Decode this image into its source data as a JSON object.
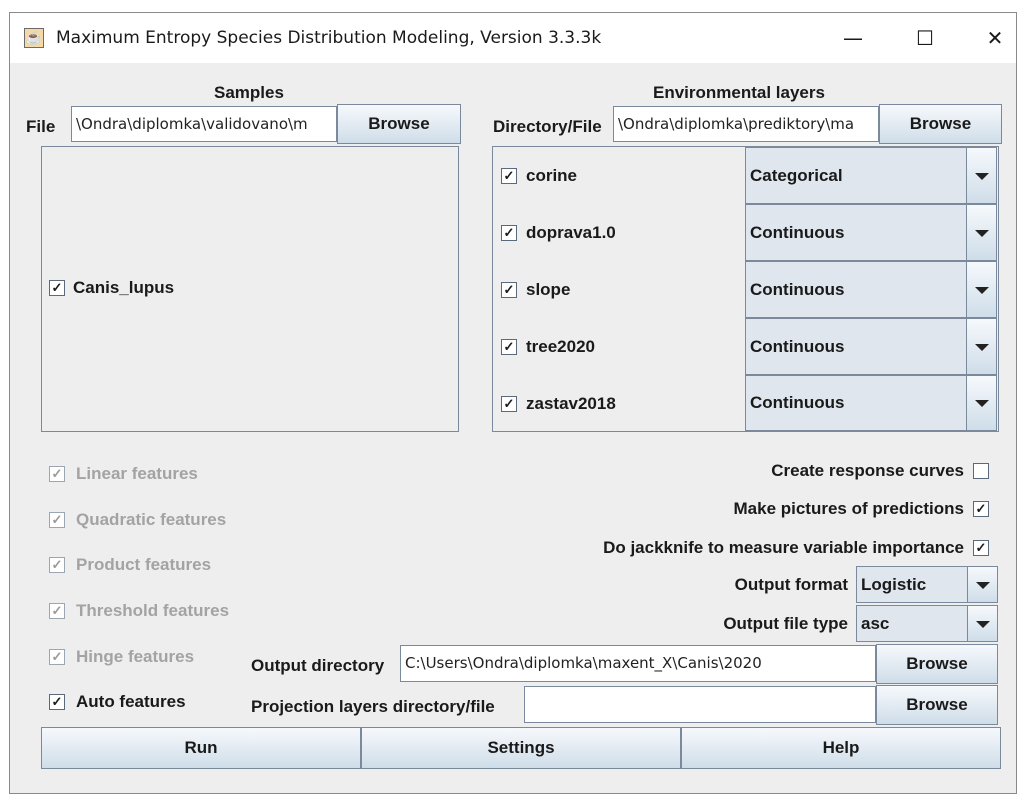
{
  "window": {
    "title": "Maximum Entropy Species Distribution Modeling, Version 3.3.3k",
    "minimize_glyph": "—",
    "maximize_glyph": "☐",
    "close_glyph": "✕"
  },
  "check_glyph": "✓",
  "samples": {
    "header": "Samples",
    "file_label": "File",
    "file_value": "\\Ondra\\diplomka\\validovano\\m",
    "browse_label": "Browse",
    "species": [
      {
        "name": "Canis_lupus",
        "checked": true
      }
    ]
  },
  "environmental_layers": {
    "header": "Environmental layers",
    "dir_label": "Directory/File",
    "dir_value": "\\Ondra\\diplomka\\prediktory\\ma",
    "browse_label": "Browse",
    "layers": [
      {
        "name": "corine",
        "checked": true,
        "type": "Categorical"
      },
      {
        "name": "doprava1.0",
        "checked": true,
        "type": "Continuous"
      },
      {
        "name": "slope",
        "checked": true,
        "type": "Continuous"
      },
      {
        "name": "tree2020",
        "checked": true,
        "type": "Continuous"
      },
      {
        "name": "zastav2018",
        "checked": true,
        "type": "Continuous"
      }
    ]
  },
  "features": [
    {
      "label": "Linear features",
      "checked": true,
      "enabled": false
    },
    {
      "label": "Quadratic features",
      "checked": true,
      "enabled": false
    },
    {
      "label": "Product features",
      "checked": true,
      "enabled": false
    },
    {
      "label": "Threshold features",
      "checked": true,
      "enabled": false
    },
    {
      "label": "Hinge features",
      "checked": true,
      "enabled": false
    },
    {
      "label": "Auto features",
      "checked": true,
      "enabled": true
    }
  ],
  "options": {
    "response_curves": {
      "label": "Create response curves",
      "checked": false
    },
    "pictures": {
      "label": "Make pictures of predictions",
      "checked": true
    },
    "jackknife": {
      "label": "Do jackknife to measure variable importance",
      "checked": true
    },
    "output_format": {
      "label": "Output format",
      "value": "Logistic"
    },
    "output_file_type": {
      "label": "Output file type",
      "value": "asc"
    }
  },
  "output": {
    "dir_label": "Output directory",
    "dir_value": "C:\\Users\\Ondra\\diplomka\\maxent_X\\Canis\\2020",
    "browse_label": "Browse",
    "projection_label": "Projection layers directory/file",
    "projection_value": "",
    "projection_browse_label": "Browse"
  },
  "actions": {
    "run": "Run",
    "settings": "Settings",
    "help": "Help"
  }
}
